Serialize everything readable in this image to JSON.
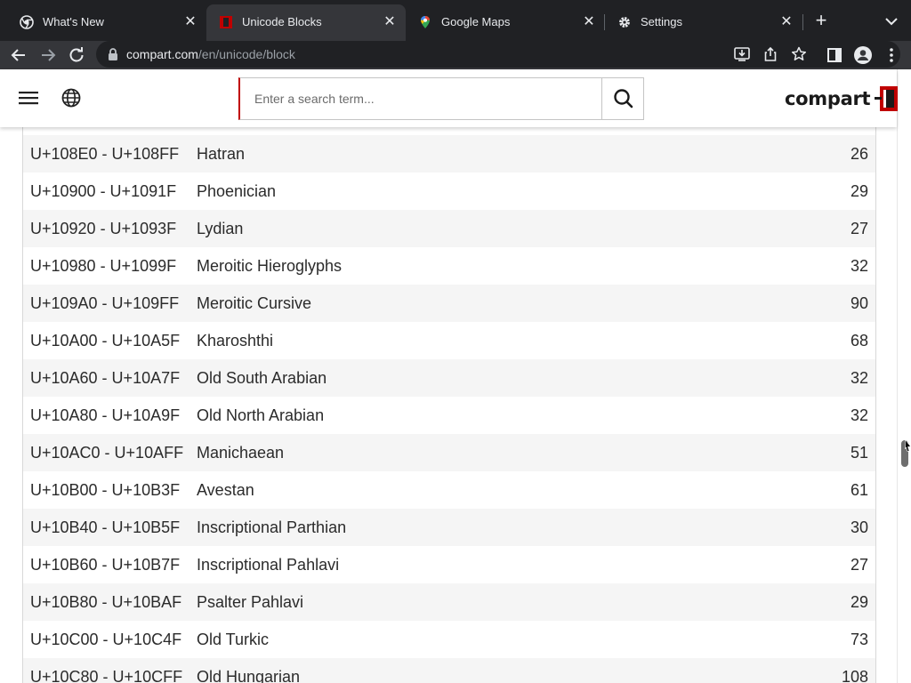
{
  "browser": {
    "tabs": [
      {
        "title": "What's New",
        "icon": "chrome-icon",
        "active": false
      },
      {
        "title": "Unicode Blocks",
        "icon": "compart-favicon",
        "active": true
      },
      {
        "title": "Google Maps",
        "icon": "google-maps-icon",
        "active": false
      },
      {
        "title": "Settings",
        "icon": "gear-icon",
        "active": false
      }
    ],
    "url_host": "compart.com",
    "url_path": "/en/unicode/block"
  },
  "site": {
    "search_placeholder": "Enter a search term...",
    "logo_text": "compart",
    "colors": {
      "accent": "#c00000",
      "row_alt": "#f5f5f5"
    }
  },
  "blocks": [
    {
      "range": "U+108E0 - U+108FF",
      "name": "Hatran",
      "count": "26"
    },
    {
      "range": "U+10900 - U+1091F",
      "name": "Phoenician",
      "count": "29"
    },
    {
      "range": "U+10920 - U+1093F",
      "name": "Lydian",
      "count": "27"
    },
    {
      "range": "U+10980 - U+1099F",
      "name": "Meroitic Hieroglyphs",
      "count": "32"
    },
    {
      "range": "U+109A0 - U+109FF",
      "name": "Meroitic Cursive",
      "count": "90"
    },
    {
      "range": "U+10A00 - U+10A5F",
      "name": "Kharoshthi",
      "count": "68"
    },
    {
      "range": "U+10A60 - U+10A7F",
      "name": "Old South Arabian",
      "count": "32"
    },
    {
      "range": "U+10A80 - U+10A9F",
      "name": "Old North Arabian",
      "count": "32"
    },
    {
      "range": "U+10AC0 - U+10AFF",
      "name": "Manichaean",
      "count": "51"
    },
    {
      "range": "U+10B00 - U+10B3F",
      "name": "Avestan",
      "count": "61"
    },
    {
      "range": "U+10B40 - U+10B5F",
      "name": "Inscriptional Parthian",
      "count": "30"
    },
    {
      "range": "U+10B60 - U+10B7F",
      "name": "Inscriptional Pahlavi",
      "count": "27"
    },
    {
      "range": "U+10B80 - U+10BAF",
      "name": "Psalter Pahlavi",
      "count": "29"
    },
    {
      "range": "U+10C00 - U+10C4F",
      "name": "Old Turkic",
      "count": "73"
    },
    {
      "range": "U+10C80 - U+10CFF",
      "name": "Old Hungarian",
      "count": "108"
    }
  ]
}
